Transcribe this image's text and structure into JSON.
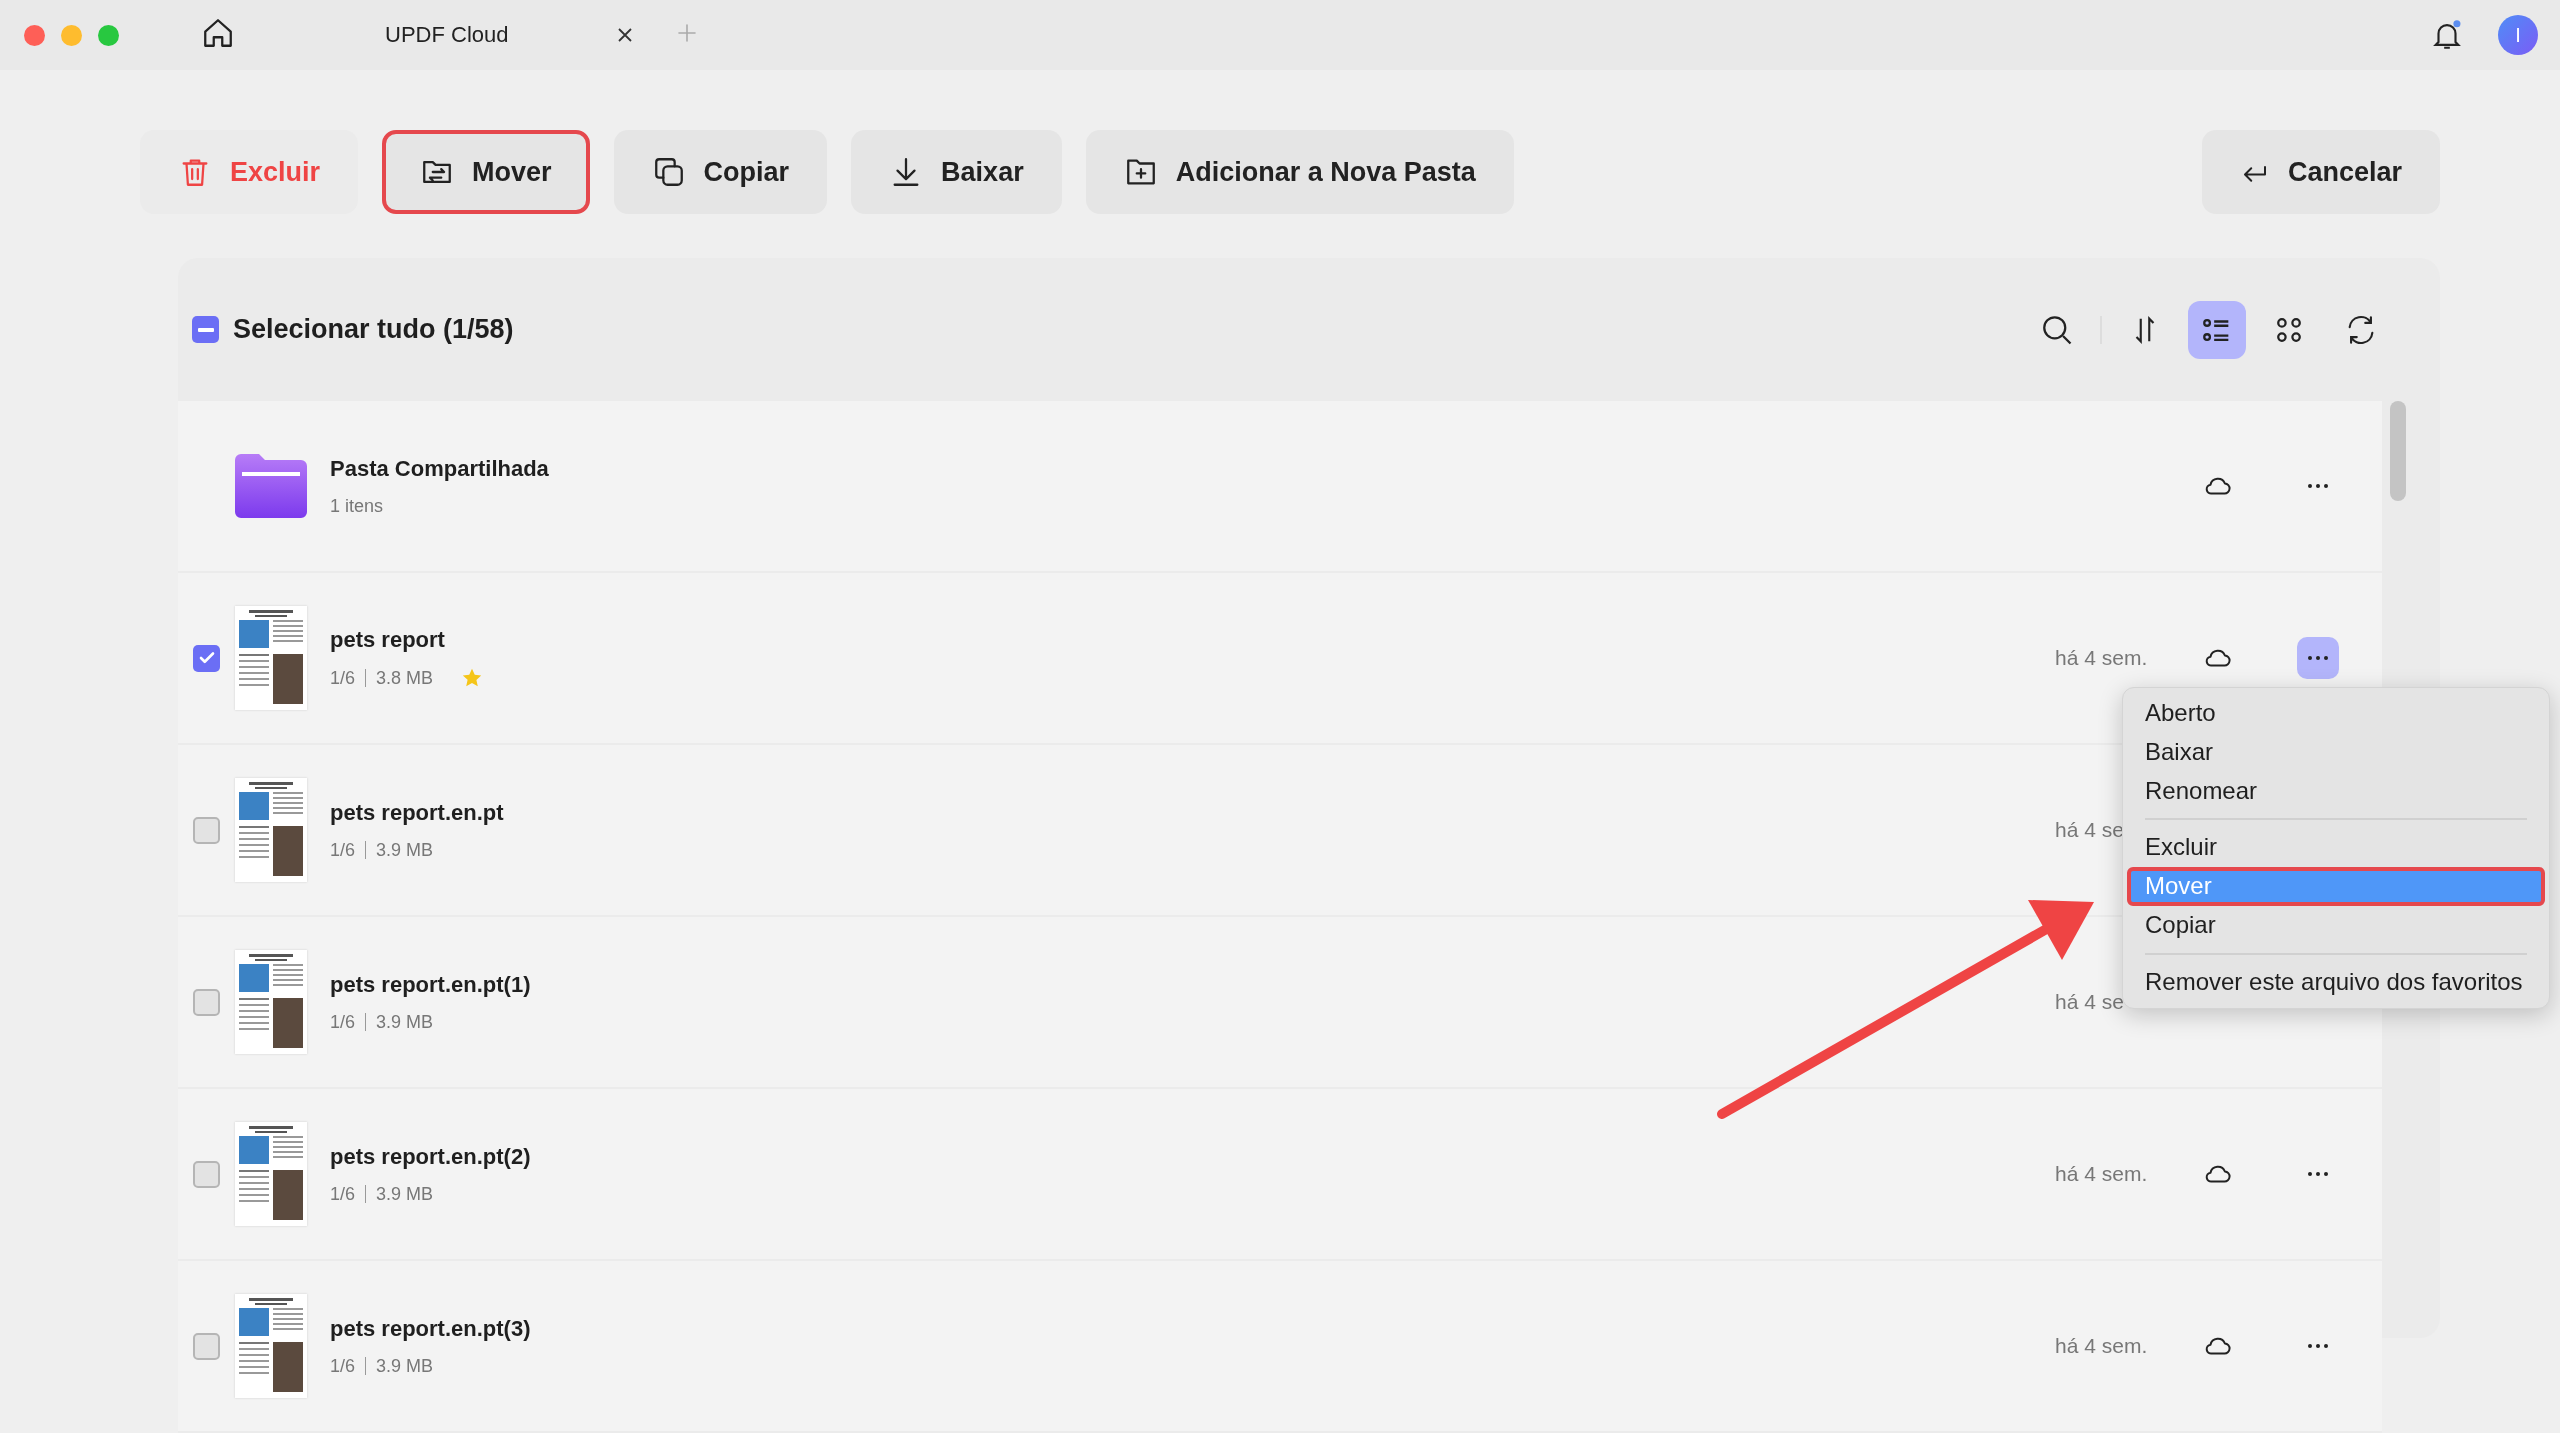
{
  "window": {
    "tab_title": "UPDF Cloud",
    "avatar_letter": "I"
  },
  "actions": [
    {
      "label": "Excluir",
      "kind": "delete",
      "highlighted": false
    },
    {
      "label": "Mover",
      "kind": "move",
      "highlighted": true
    },
    {
      "label": "Copiar",
      "kind": "copy",
      "highlighted": false
    },
    {
      "label": "Baixar",
      "kind": "download",
      "highlighted": false
    },
    {
      "label": "Adicionar a Nova Pasta",
      "kind": "new-folder",
      "highlighted": false
    },
    {
      "label": "Cancelar",
      "kind": "cancel",
      "highlighted": false
    }
  ],
  "select_all": {
    "label": "Selecionar tudo (1/58)",
    "indeterminate": true
  },
  "view_modes": [
    {
      "kind": "list",
      "selected": true
    },
    {
      "kind": "grid",
      "selected": false
    }
  ],
  "files": [
    {
      "kind": "folder",
      "name": "Pasta Compartilhada",
      "meta": "1 itens"
    },
    {
      "kind": "file",
      "name": "pets report",
      "pages": "1/6",
      "size": "3.8 MB",
      "favorite": true,
      "checked": true,
      "date": "há 4 sem.",
      "menu_open": true
    },
    {
      "kind": "file",
      "name": "pets report.en.pt",
      "pages": "1/6",
      "size": "3.9 MB",
      "checked": false,
      "date": "há 4 se",
      "covered": true
    },
    {
      "kind": "file",
      "name": "pets report.en.pt(1)",
      "pages": "1/6",
      "size": "3.9 MB",
      "checked": false,
      "date": "há 4 se",
      "covered": true
    },
    {
      "kind": "file",
      "name": "pets report.en.pt(2)",
      "pages": "1/6",
      "size": "3.9 MB",
      "checked": false,
      "date": "há 4 sem."
    },
    {
      "kind": "file",
      "name": "pets report.en.pt(3)",
      "pages": "1/6",
      "size": "3.9 MB",
      "checked": false,
      "date": "há 4 sem."
    }
  ],
  "context_menu": {
    "groups": [
      [
        {
          "label": "Aberto",
          "selected": false
        },
        {
          "label": "Baixar",
          "selected": false
        },
        {
          "label": "Renomear",
          "selected": false
        }
      ],
      [
        {
          "label": "Excluir",
          "selected": false
        },
        {
          "label": "Mover",
          "selected": true,
          "highlighted": true
        },
        {
          "label": "Copiar",
          "selected": false
        }
      ],
      [
        {
          "label": "Remover este arquivo dos favoritos",
          "selected": false
        }
      ]
    ]
  }
}
